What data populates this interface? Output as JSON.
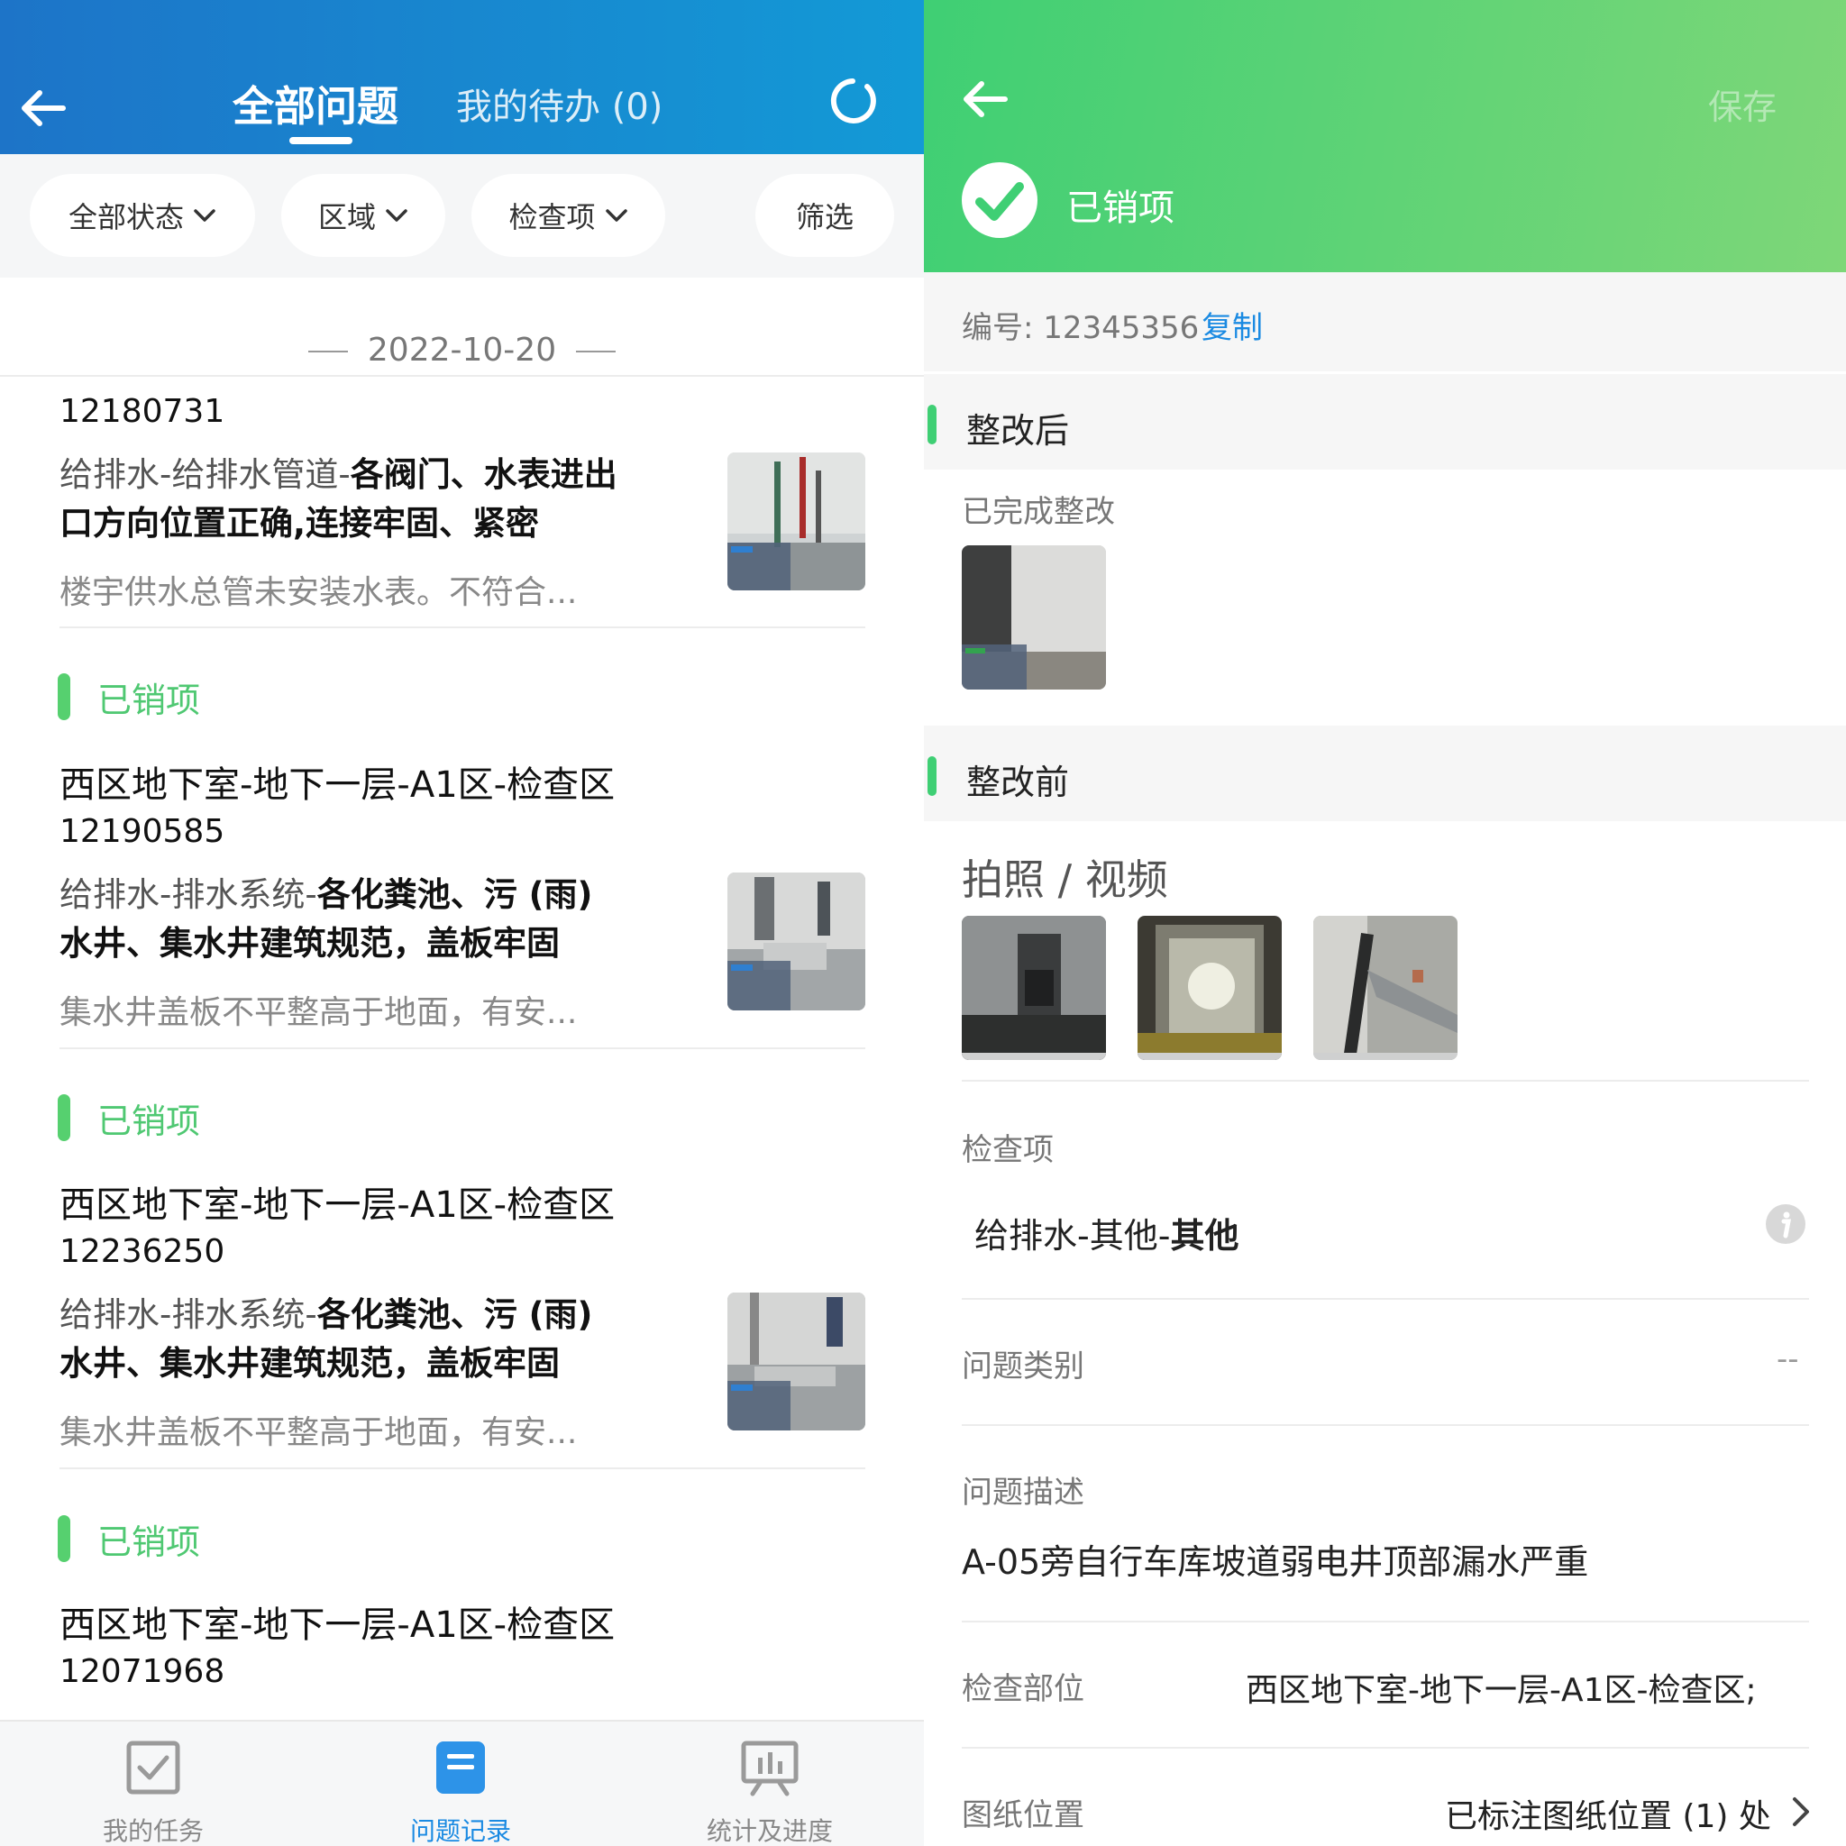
{
  "left": {
    "tabs": {
      "active": "全部问题",
      "todo": "我的待办 (0)"
    },
    "filters": [
      "全部状态",
      "区域",
      "检查项",
      "筛选"
    ],
    "date": "2022-10-20",
    "cards": [
      {
        "id": "12180731",
        "category": "给排水-给排水管道-",
        "item_line1": "各阀门、水表进出",
        "item_line2": "口方向位置正确,连接牢固、紧密",
        "desc": "楼宇供水总管未安装水表。不符合..."
      },
      {
        "status": "已销项",
        "location": "西区地下室-地下一层-A1区-检查区",
        "id": "12190585",
        "category": "给排水-排水系统-",
        "item_line1": "各化粪池、污 (雨)",
        "item_line2": "水井、集水井建筑规范，盖板牢固",
        "desc": "集水井盖板不平整高于地面，有安..."
      },
      {
        "status": "已销项",
        "location": "西区地下室-地下一层-A1区-检查区",
        "id": "12236250",
        "category": "给排水-排水系统-",
        "item_line1": "各化粪池、污 (雨)",
        "item_line2": "水井、集水井建筑规范，盖板牢固",
        "desc": "集水井盖板不平整高于地面，有安..."
      },
      {
        "status": "已销项",
        "location": "西区地下室-地下一层-A1区-检查区",
        "id": "12071968"
      }
    ],
    "nav": [
      {
        "label": "我的任务",
        "icon": "task-check-icon",
        "active": false
      },
      {
        "label": "问题记录",
        "icon": "issue-record-icon",
        "active": true
      },
      {
        "label": "统计及进度",
        "icon": "stats-board-icon",
        "active": false
      }
    ]
  },
  "right": {
    "save": "保存",
    "status": "已销项",
    "code_label": "编号: 12345356",
    "copy": "复制",
    "after_title": "整改后",
    "after_label": "已完成整改",
    "before_title": "整改前",
    "media_label": "拍照 / 视频",
    "check_item_label": "检查项",
    "check_item_prefix": "给排水-其他-",
    "check_item_bold": "其他",
    "issue_type_label": "问题类别",
    "issue_type_value": "--",
    "issue_desc_label": "问题描述",
    "issue_desc_value": "A-05旁自行车库坡道弱电井顶部漏水严重",
    "part_label": "检查部位",
    "part_value": "西区地下室-地下一层-A1区-检查区;",
    "drawing_label": "图纸位置",
    "drawing_value": "已标注图纸位置 (1) 处"
  },
  "colors": {
    "left_header": "#139ad6",
    "right_header": "#3fcf74",
    "status_green": "#4fc872",
    "nav_active": "#1a8ae2"
  }
}
